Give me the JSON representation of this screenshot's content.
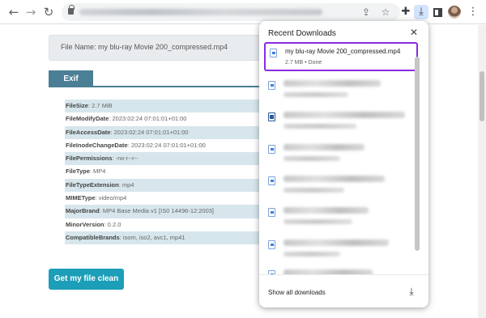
{
  "browser": {
    "back_glyph": "←",
    "forward_glyph": "→",
    "reload_glyph": "↻",
    "share_glyph": "⇪",
    "star_glyph": "☆",
    "extensions_glyph": "✚",
    "download_glyph": "⤓",
    "menu_glyph": "⋮"
  },
  "page": {
    "file_name_label": "File Name: my blu-ray Movie 200_compressed.mp4",
    "tab_label": "Exif",
    "metadata": [
      {
        "key": "FileSize",
        "value": ": 2.7 MiB"
      },
      {
        "key": "FileModifyDate",
        "value": ": 2023:02:24 07:01:01+01:00"
      },
      {
        "key": "FileAccessDate",
        "value": ": 2023:02:24 07:01:01+01:00"
      },
      {
        "key": "FileInodeChangeDate",
        "value": ": 2023:02:24 07:01:01+01:00"
      },
      {
        "key": "FilePermissions",
        "value": ": -rw-r--r--"
      },
      {
        "key": "FileType",
        "value": ": MP4"
      },
      {
        "key": "FileTypeExtension",
        "value": ": mp4"
      },
      {
        "key": "MIMEType",
        "value": ": video/mp4"
      },
      {
        "key": "MajorBrand",
        "value": ": MP4 Base Media v1 [IS0 14496-12:2003]"
      },
      {
        "key": "MinorVersion",
        "value": ": 0.2.0"
      },
      {
        "key": "CompatibleBrands",
        "value": ": isom, iso2, avc1, mp41"
      }
    ],
    "clean_button_label": "Get my file clean"
  },
  "downloads": {
    "title": "Recent Downloads",
    "close_glyph": "✕",
    "first_item": {
      "name": "my blu-ray Movie 200_compressed.mp4",
      "status": "2.7 MB • Done"
    },
    "show_all_label": "Show all downloads",
    "open_folder_glyph": "⤓",
    "highlight_color": "#8a2be2"
  }
}
